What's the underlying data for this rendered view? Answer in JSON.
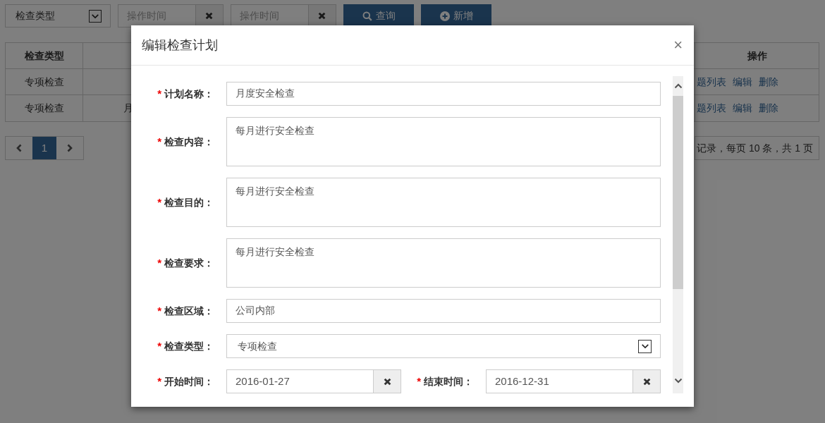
{
  "toolbar": {
    "type_select": {
      "value": "检查类型"
    },
    "date_from": {
      "placeholder": "操作时间"
    },
    "date_to": {
      "placeholder": "操作时间"
    },
    "buttons": [
      {
        "kind": "search",
        "label": "查询"
      },
      {
        "kind": "add",
        "label": "新增"
      }
    ]
  },
  "table": {
    "columns": [
      {
        "label": "检查类型"
      },
      {
        "label": "操作"
      }
    ],
    "rows": [
      {
        "type": "专项检查",
        "column_2": "",
        "actions": [
          "题列表",
          "编辑",
          "删除"
        ]
      },
      {
        "type": "专项检查",
        "column_2": "月",
        "actions": [
          "题列表",
          "编辑",
          "删除"
        ]
      }
    ]
  },
  "pagination": {
    "pages": [
      {
        "label": "1",
        "selected": true
      }
    ],
    "summary": "记录，每页 10 条，共 1 页"
  },
  "dialog": {
    "title": "编辑检查计划",
    "close": "×",
    "required_mark": "*",
    "fields": [
      {
        "kind": "text",
        "label": "计划名称：",
        "required": true,
        "value": "月度安全检查"
      },
      {
        "kind": "textarea",
        "label": "检查内容：",
        "required": true,
        "value": "每月进行安全检查"
      },
      {
        "kind": "textarea",
        "label": "检查目的：",
        "required": true,
        "value": "每月进行安全检查"
      },
      {
        "kind": "textarea",
        "label": "检查要求：",
        "required": true,
        "value": "每月进行安全检查"
      },
      {
        "kind": "text",
        "label": "检查区域：",
        "required": true,
        "value": "公司内部"
      },
      {
        "kind": "select",
        "label": "检查类型：",
        "required": true,
        "value": "专项检查"
      },
      {
        "kind": "daterange",
        "label": "开始时间：",
        "required": true,
        "value": "2016-01-27",
        "label_2": "结束时间：",
        "required_2": true,
        "value_2": "2016-12-31"
      }
    ]
  }
}
